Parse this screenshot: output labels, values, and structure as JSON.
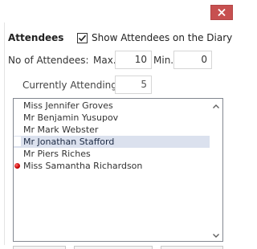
{
  "window": {
    "close_icon": "close-icon",
    "close_color": "#c75050"
  },
  "attendees": {
    "heading": "Attendees",
    "show_on_diary_label": "Show Attendees on the Diary",
    "show_on_diary_checked": true,
    "no_of_attendees_label": "No of Attendees:",
    "max_label": "Max.",
    "max_value": "10",
    "min_label": "Min.",
    "min_value": "0",
    "currently_attending_label": "Currently Attending",
    "currently_attending_value": "5"
  },
  "list": {
    "items": [
      {
        "name": "Miss Jennifer Groves",
        "selected": false,
        "marker": ""
      },
      {
        "name": "Mr Benjamin Yusupov",
        "selected": false,
        "marker": ""
      },
      {
        "name": "Mr Mark Webster",
        "selected": false,
        "marker": ""
      },
      {
        "name": "Mr Jonathan Stafford",
        "selected": true,
        "marker": ""
      },
      {
        "name": "Mr Piers Riches",
        "selected": false,
        "marker": ""
      },
      {
        "name": "Miss Samantha Richardson",
        "selected": false,
        "marker": "red-dot"
      }
    ],
    "scroll_up_icon": "chevron-up-icon",
    "scroll_down_icon": "chevron-down-icon"
  }
}
